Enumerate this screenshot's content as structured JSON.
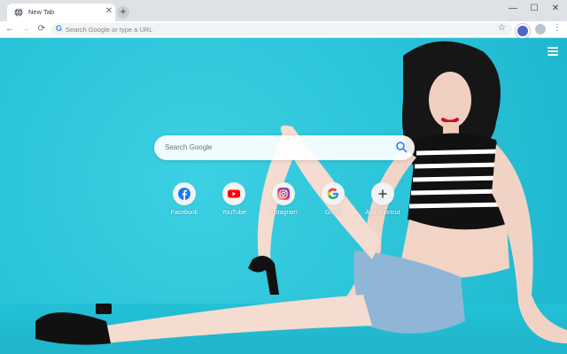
{
  "browser": {
    "tab_title": "New Tab",
    "new_tab_symbol": "+",
    "close_symbol": "✕",
    "omnibox_placeholder": "Search Google or type a URL",
    "omnibox_g": "G"
  },
  "window_controls": {
    "minimize": "—",
    "maximize": "☐",
    "close": "✕"
  },
  "newtab_page": {
    "search_placeholder": "Search Google",
    "shortcuts": [
      {
        "label": "Facebook",
        "icon": "facebook-icon",
        "color": "#1877f2"
      },
      {
        "label": "YouTube",
        "icon": "youtube-icon",
        "color": "#ff0000"
      },
      {
        "label": "Instagram",
        "icon": "instagram-icon",
        "color": "#c13584"
      },
      {
        "label": "Gmail",
        "icon": "google-icon",
        "color": "#4285f4"
      },
      {
        "label": "Add shortcut",
        "icon": "plus-icon",
        "color": "#3c4043"
      }
    ]
  },
  "colors": {
    "background": "#29c4d8",
    "accent": "#1a73e8"
  }
}
